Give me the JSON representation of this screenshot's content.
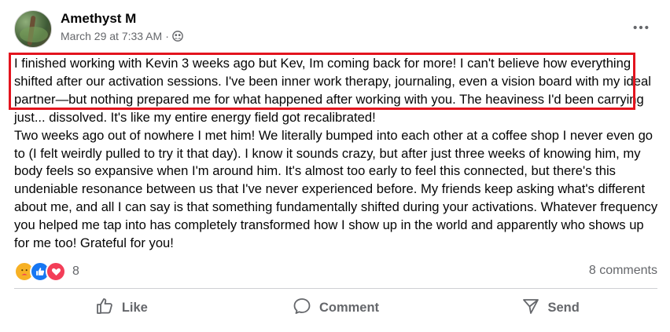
{
  "post": {
    "author": "Amethyst M",
    "timestamp": "March 29 at 7:33 AM",
    "separator": "·",
    "privacy_icon": "friends-globe-icon",
    "paragraphs": [
      "I finished working with Kevin 3 weeks ago but Kev, Im coming back for more! I can't believe how everything shifted after our activation sessions. I've been inner work therapy, journaling, even a vision board with my ideal partner—but nothing prepared me for what happened after working with you. The heaviness I'd been carrying just... dissolved. It's like my entire energy field got recalibrated!",
      "Two weeks ago out of nowhere I met him! We literally bumped into each other at a coffee shop I never even go to (I felt weirdly pulled to try it that day). I know it sounds crazy, but after just three weeks of knowing him, my body feels so expansive when I'm around him. It's almost too early to feel this connected, but there's this undeniable resonance between us that I've never experienced before. My friends keep asking what's different about me, and all I can say is that something fundamentally shifted during your activations. Whatever frequency you helped me tap into has completely transformed how I show up in the world and apparently who shows up for me too! Grateful for you!"
    ],
    "highlight_color": "#e3141e"
  },
  "reactions": {
    "types": [
      "care",
      "like",
      "love"
    ],
    "count": "8"
  },
  "comments_label": "8 comments",
  "actions": {
    "like": "Like",
    "comment": "Comment",
    "send": "Send"
  }
}
